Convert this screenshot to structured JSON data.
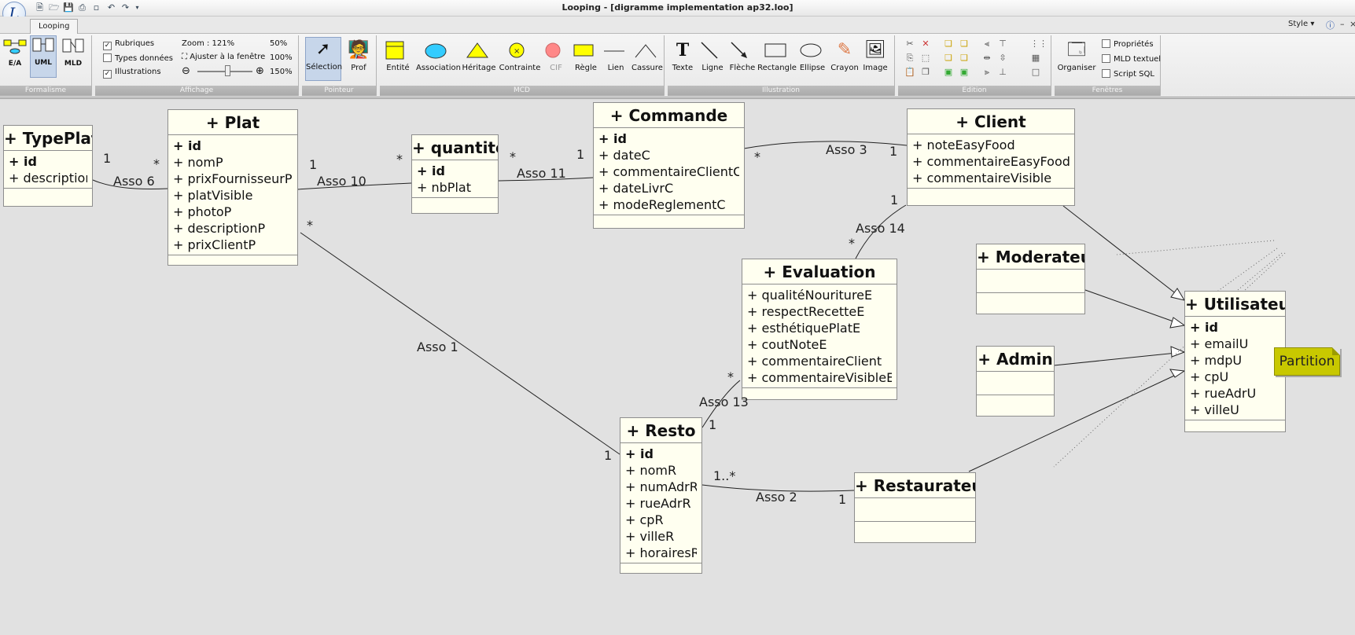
{
  "window": {
    "title": "Looping - [digramme implementation ap32.loo]",
    "app_icon": "L64"
  },
  "tabs": {
    "active": "Looping"
  },
  "style_menu": "Style",
  "ribbon": {
    "formalisme": {
      "caption": "Formalisme",
      "ea": "E/A",
      "uml": "UML",
      "mld": "MLD"
    },
    "affichage": {
      "caption": "Affichage",
      "rubriques": "Rubriques",
      "types": "Types données",
      "illustrations": "Illustrations",
      "zoom": "Zoom : 121%",
      "fit": "Ajuster à la fenêtre",
      "z50": "50%",
      "z100": "100%",
      "z150": "150%"
    },
    "pointeur": {
      "caption": "Pointeur",
      "selection": "Sélection",
      "prof": "Prof"
    },
    "mcd": {
      "caption": "MCD",
      "entite": "Entité",
      "association": "Association",
      "heritage": "Héritage",
      "contrainte": "Contrainte",
      "cif": "CIF",
      "regle": "Règle",
      "lien": "Lien",
      "cassure": "Cassure"
    },
    "illustration": {
      "caption": "Illustration",
      "texte": "Texte",
      "ligne": "Ligne",
      "fleche": "Flèche",
      "rectangle": "Rectangle",
      "ellipse": "Ellipse",
      "crayon": "Crayon",
      "image": "Image"
    },
    "edition": {
      "caption": "Edition"
    },
    "fenetres": {
      "caption": "Fenêtres",
      "organiser": "Organiser",
      "proprietes": "Propriétés",
      "mld_textuel": "MLD textuel",
      "script_sql": "Script SQL"
    }
  },
  "classes": {
    "typeplat": {
      "name": "+ TypePlat",
      "attrs": [
        {
          "t": "+ id",
          "pk": true
        },
        {
          "t": "+ description"
        }
      ]
    },
    "plat": {
      "name": "+ Plat",
      "attrs": [
        {
          "t": "+ id",
          "pk": true
        },
        {
          "t": "+ nomP"
        },
        {
          "t": "+ prixFournisseurP"
        },
        {
          "t": "+ platVisible"
        },
        {
          "t": "+ photoP"
        },
        {
          "t": "+ descriptionP"
        },
        {
          "t": "+ prixClientP"
        }
      ]
    },
    "quantite": {
      "name": "+ quantite",
      "attrs": [
        {
          "t": "+ id",
          "pk": true
        },
        {
          "t": "+ nbPlat"
        }
      ]
    },
    "commande": {
      "name": "+ Commande",
      "attrs": [
        {
          "t": "+ id",
          "pk": true
        },
        {
          "t": "+ dateC"
        },
        {
          "t": "+ commentaireClientC"
        },
        {
          "t": "+ dateLivrC"
        },
        {
          "t": "+ modeReglementC"
        }
      ]
    },
    "client": {
      "name": "+ Client",
      "attrs": [
        {
          "t": "+ noteEasyFood"
        },
        {
          "t": "+ commentaireEasyFood"
        },
        {
          "t": "+ commentaireVisible"
        }
      ]
    },
    "evaluation": {
      "name": "+ Evaluation",
      "attrs": [
        {
          "t": "+ qualitéNouritureE"
        },
        {
          "t": "+ respectRecetteE"
        },
        {
          "t": "+ esthétiquePlatE"
        },
        {
          "t": "+ coutNoteE"
        },
        {
          "t": "+ commentaireClient"
        },
        {
          "t": "+ commentaireVisibleE"
        }
      ]
    },
    "moderateur": {
      "name": "+ Moderateur",
      "attrs": []
    },
    "admin": {
      "name": "+ Admin",
      "attrs": []
    },
    "utilisateur": {
      "name": "+ Utilisateur",
      "attrs": [
        {
          "t": "+ id",
          "pk": true
        },
        {
          "t": "+ emailU"
        },
        {
          "t": "+ mdpU"
        },
        {
          "t": "+ cpU"
        },
        {
          "t": "+ rueAdrU"
        },
        {
          "t": "+ villeU"
        }
      ]
    },
    "resto": {
      "name": "+ Resto",
      "attrs": [
        {
          "t": "+ id",
          "pk": true
        },
        {
          "t": "+ nomR"
        },
        {
          "t": "+ numAdrR"
        },
        {
          "t": "+ rueAdrR"
        },
        {
          "t": "+ cpR"
        },
        {
          "t": "+ villeR"
        },
        {
          "t": "+ horairesR"
        }
      ]
    },
    "restaurateur": {
      "name": "+ Restaurateur",
      "attrs": []
    }
  },
  "associations": {
    "a6": "Asso 6",
    "a10": "Asso 10",
    "a11": "Asso 11",
    "a3": "Asso 3",
    "a14": "Asso 14",
    "a1": "Asso 1",
    "a13": "Asso 13",
    "a2": "Asso 2"
  },
  "multiplicities": {
    "a6_left": "1",
    "a6_right": "*",
    "a10_left": "1",
    "a10_right": "*",
    "a11_left": "*",
    "a11_right": "1",
    "a3_left": "*",
    "a3_right": "1",
    "a14_top": "1",
    "a14_bottom": "*",
    "a1_top": "*",
    "a1_bottom": "1",
    "a13_top": "*",
    "a13_bottom": "1",
    "a2_left": "1..*",
    "a2_right": "1"
  },
  "note": "Partition"
}
